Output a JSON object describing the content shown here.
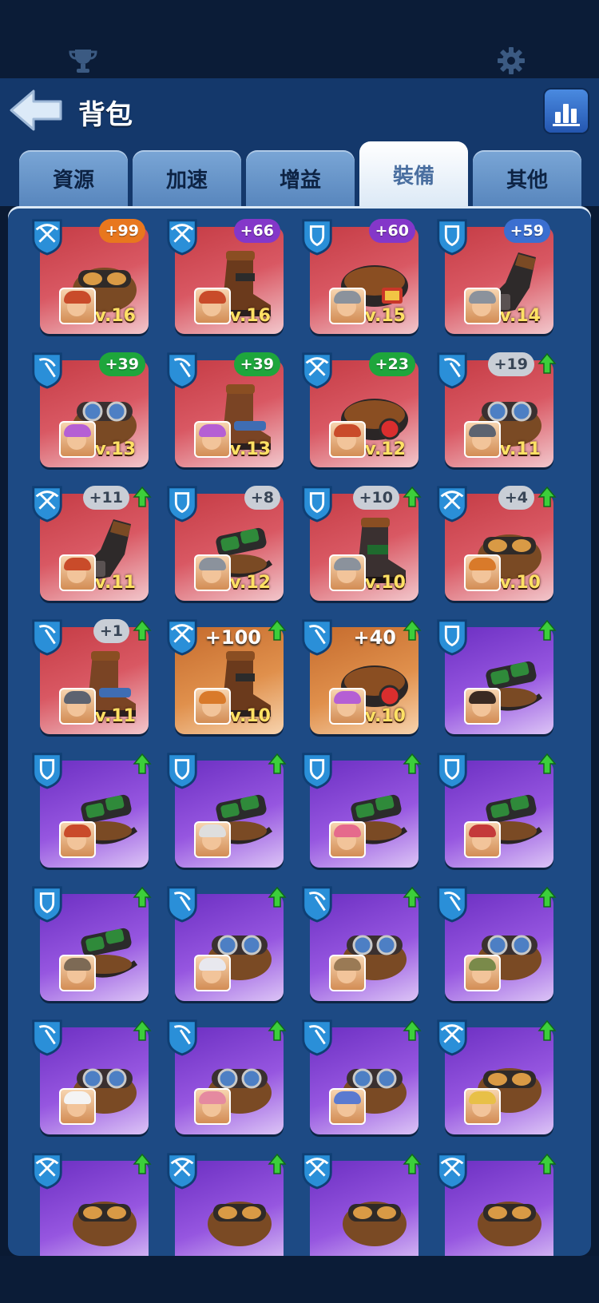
{
  "header": {
    "title": "背包"
  },
  "tabs": [
    {
      "label": "資源",
      "active": false
    },
    {
      "label": "加速",
      "active": false
    },
    {
      "label": "增益",
      "active": false
    },
    {
      "label": "裝備",
      "active": true
    },
    {
      "label": "其他",
      "active": false
    }
  ],
  "colors": {
    "accent": "#1d4a84",
    "tab_active": "#dce9f6",
    "level_text": "#ffe164"
  },
  "items": [
    {
      "badge": "crossbow",
      "rarity": "red",
      "gear": "goggles-brown",
      "plus": "+99",
      "plus_color": "orange",
      "level": "Lv.16",
      "upgrade": false,
      "hero": "dwarf-red"
    },
    {
      "badge": "crossbow",
      "rarity": "red",
      "gear": "boot-brown",
      "plus": "+66",
      "plus_color": "purple",
      "level": "Lv.16",
      "upgrade": false,
      "hero": "dwarf-red"
    },
    {
      "badge": "shield",
      "rarity": "red",
      "gear": "belt-brown",
      "plus": "+60",
      "plus_color": "purple",
      "level": "Lv.15",
      "upgrade": false,
      "hero": "knight-gray"
    },
    {
      "badge": "shield",
      "rarity": "red",
      "gear": "gauntlet-dark",
      "plus": "+59",
      "plus_color": "blue",
      "level": "Lv.14",
      "upgrade": false,
      "hero": "knight-gray"
    },
    {
      "badge": "pickaxe",
      "rarity": "red",
      "gear": "goggles-blue",
      "plus": "+39",
      "plus_color": "green",
      "level": "Lv.13",
      "upgrade": false,
      "hero": "clown-purple"
    },
    {
      "badge": "pickaxe",
      "rarity": "red",
      "gear": "boot-blue",
      "plus": "+39",
      "plus_color": "green",
      "level": "Lv.13",
      "upgrade": false,
      "hero": "clown-purple"
    },
    {
      "badge": "crossbow",
      "rarity": "red",
      "gear": "belt-red",
      "plus": "+23",
      "plus_color": "green",
      "level": "Lv.12",
      "upgrade": false,
      "hero": "dwarf-red"
    },
    {
      "badge": "pickaxe",
      "rarity": "red",
      "gear": "goggles-blue",
      "plus": "+19",
      "plus_color": "gray",
      "level": "Lv.11",
      "upgrade": true,
      "hero": "miner-gray"
    },
    {
      "badge": "crossbow",
      "rarity": "red",
      "gear": "gauntlet-dark",
      "plus": "+11",
      "plus_color": "gray",
      "level": "Lv.11",
      "upgrade": true,
      "hero": "dwarf-red"
    },
    {
      "badge": "shield",
      "rarity": "red",
      "gear": "goggles-green",
      "plus": "+8",
      "plus_color": "gray",
      "level": "Lv.12",
      "upgrade": false,
      "hero": "knight-gray"
    },
    {
      "badge": "shield",
      "rarity": "red",
      "gear": "boot-dark",
      "plus": "+10",
      "plus_color": "gray",
      "level": "Lv.10",
      "upgrade": true,
      "hero": "knight-gray"
    },
    {
      "badge": "crossbow",
      "rarity": "red",
      "gear": "goggles-brown",
      "plus": "+4",
      "plus_color": "gray",
      "level": "Lv.10",
      "upgrade": true,
      "hero": "cowboy-orange"
    },
    {
      "badge": "pickaxe",
      "rarity": "red",
      "gear": "boot-blue",
      "plus": "+1",
      "plus_color": "gray",
      "level": "Lv.11",
      "upgrade": true,
      "hero": "miner-gray"
    },
    {
      "badge": "crossbow",
      "rarity": "orange",
      "gear": "boot-brown",
      "plus": "+100",
      "plus_color": "big",
      "level": "Lv.10",
      "upgrade": true,
      "hero": "cowboy-orange"
    },
    {
      "badge": "pickaxe",
      "rarity": "orange",
      "gear": "belt-red",
      "plus": "+40",
      "plus_color": "big",
      "level": "Lv.10",
      "upgrade": true,
      "hero": "clown-purple"
    },
    {
      "badge": "shield",
      "rarity": "purple",
      "gear": "goggles-green",
      "plus": "",
      "plus_color": "",
      "level": "",
      "upgrade": true,
      "hero": "woman-dark"
    },
    {
      "badge": "shield",
      "rarity": "purple",
      "gear": "goggles-green",
      "plus": "",
      "plus_color": "",
      "level": "",
      "upgrade": true,
      "hero": "redhead"
    },
    {
      "badge": "shield",
      "rarity": "purple",
      "gear": "goggles-green",
      "plus": "",
      "plus_color": "",
      "level": "",
      "upgrade": true,
      "hero": "old-man"
    },
    {
      "badge": "shield",
      "rarity": "purple",
      "gear": "goggles-green",
      "plus": "",
      "plus_color": "",
      "level": "",
      "upgrade": true,
      "hero": "boxer-pink"
    },
    {
      "badge": "shield",
      "rarity": "purple",
      "gear": "goggles-green",
      "plus": "",
      "plus_color": "",
      "level": "",
      "upgrade": true,
      "hero": "robot-red"
    },
    {
      "badge": "shield",
      "rarity": "purple",
      "gear": "goggles-green",
      "plus": "",
      "plus_color": "",
      "level": "",
      "upgrade": true,
      "hero": "hooded"
    },
    {
      "badge": "pickaxe",
      "rarity": "purple",
      "gear": "goggles-blue",
      "plus": "",
      "plus_color": "",
      "level": "",
      "upgrade": true,
      "hero": "white-hair"
    },
    {
      "badge": "pickaxe",
      "rarity": "purple",
      "gear": "goggles-blue",
      "plus": "",
      "plus_color": "",
      "level": "",
      "upgrade": true,
      "hero": "explorer"
    },
    {
      "badge": "pickaxe",
      "rarity": "purple",
      "gear": "goggles-blue",
      "plus": "",
      "plus_color": "",
      "level": "",
      "upgrade": true,
      "hero": "goblin-mech"
    },
    {
      "badge": "pickaxe",
      "rarity": "purple",
      "gear": "goggles-blue",
      "plus": "",
      "plus_color": "",
      "level": "",
      "upgrade": true,
      "hero": "chef-white"
    },
    {
      "badge": "pickaxe",
      "rarity": "purple",
      "gear": "goggles-blue",
      "plus": "",
      "plus_color": "",
      "level": "",
      "upgrade": true,
      "hero": "pink-girl"
    },
    {
      "badge": "pickaxe",
      "rarity": "purple",
      "gear": "goggles-blue",
      "plus": "",
      "plus_color": "",
      "level": "",
      "upgrade": true,
      "hero": "viking-blue"
    },
    {
      "badge": "crossbow",
      "rarity": "purple",
      "gear": "goggles-brown",
      "plus": "",
      "plus_color": "",
      "level": "",
      "upgrade": true,
      "hero": "blond"
    },
    {
      "badge": "crossbow",
      "rarity": "purple",
      "gear": "goggles-brown",
      "plus": "",
      "plus_color": "",
      "level": "",
      "upgrade": true,
      "hero": ""
    },
    {
      "badge": "crossbow",
      "rarity": "purple",
      "gear": "goggles-brown",
      "plus": "",
      "plus_color": "",
      "level": "",
      "upgrade": true,
      "hero": ""
    },
    {
      "badge": "crossbow",
      "rarity": "purple",
      "gear": "goggles-brown",
      "plus": "",
      "plus_color": "",
      "level": "",
      "upgrade": true,
      "hero": ""
    },
    {
      "badge": "crossbow",
      "rarity": "purple",
      "gear": "goggles-brown",
      "plus": "",
      "plus_color": "",
      "level": "",
      "upgrade": true,
      "hero": ""
    }
  ]
}
